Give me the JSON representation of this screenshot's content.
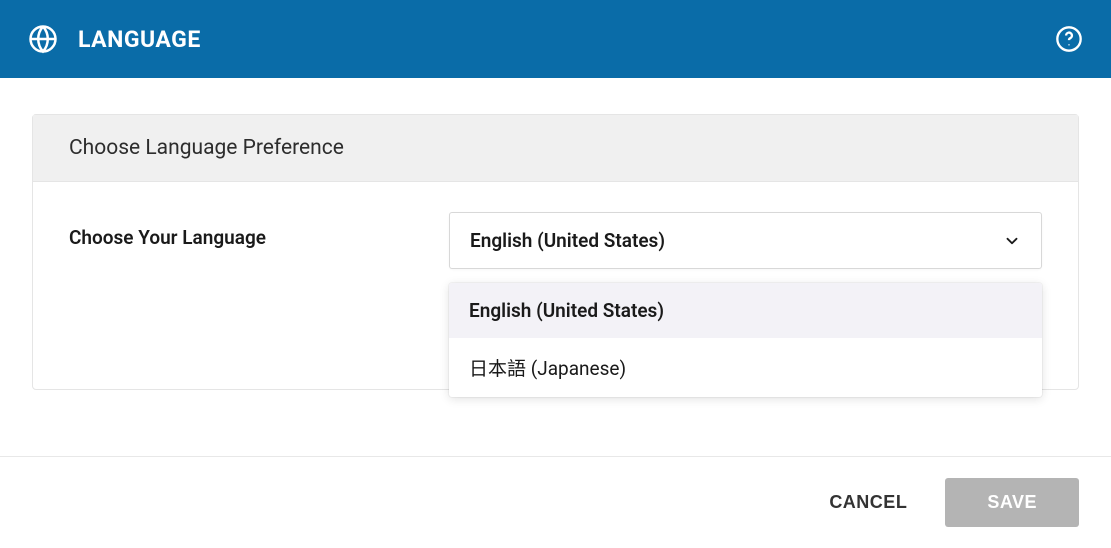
{
  "header": {
    "title": "LANGUAGE"
  },
  "card": {
    "title": "Choose Language Preference",
    "field_label": "Choose Your Language"
  },
  "select": {
    "value": "English (United States)",
    "options": [
      {
        "label": "English (United States)",
        "selected": true
      },
      {
        "label": "日本語 (Japanese)",
        "selected": false
      }
    ]
  },
  "footer": {
    "cancel": "CANCEL",
    "save": "SAVE"
  }
}
